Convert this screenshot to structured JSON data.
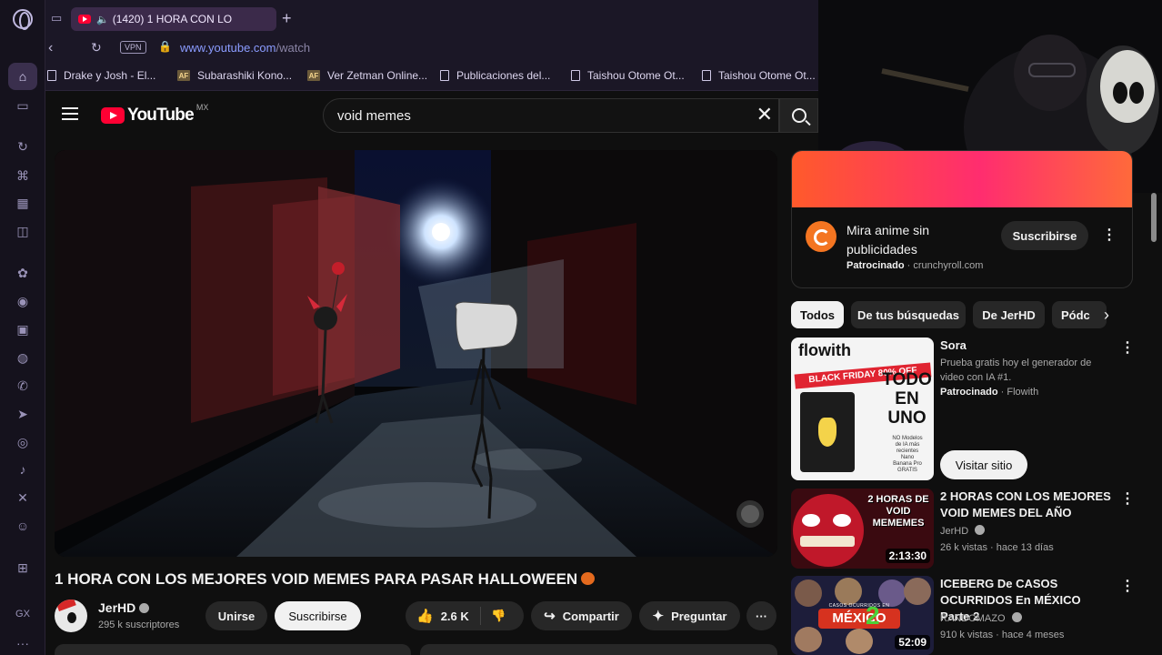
{
  "browser": {
    "tab_title": "(1420) 1 HORA CON LO",
    "new_tab": "+",
    "vpn_label": "VPN",
    "url_host": "www.youtube.com",
    "url_path": "/watch",
    "bookmarks": [
      {
        "label": "Drake y Josh - El...",
        "icon": "page-icon"
      },
      {
        "label": "Subarashiki Kono...",
        "icon": "af"
      },
      {
        "label": "Ver Zetman Online...",
        "icon": "af"
      },
      {
        "label": "Publicaciones del...",
        "icon": "page-icon"
      },
      {
        "label": "Taishou Otome Ot...",
        "icon": "page-icon"
      },
      {
        "label": "Taishou Otome Ot...",
        "icon": "page-icon"
      }
    ],
    "bookmark_af_text": "AF"
  },
  "sidebar": {
    "gx_label": "GX",
    "more_label": "···"
  },
  "youtube": {
    "logo_text": "YouTube",
    "country_code": "MX",
    "search_query": "void memes",
    "clear_symbol": "✕"
  },
  "video": {
    "title": "1 HORA CON LOS MEJORES VOID MEMES PARA PASAR HALLOWEEN",
    "channel": "JerHD",
    "subscribers": "295 k suscriptores",
    "join_label": "Unirse",
    "subscribe_label": "Suscribirse",
    "likes": "2.6 K",
    "share_label": "Compartir",
    "ask_label": "Preguntar",
    "more_label": "···"
  },
  "ad": {
    "title": "Mira anime sin publicidades",
    "sponsored": "Patrocinado",
    "domain": "crunchyroll.com",
    "subscribe_label": "Suscribirse"
  },
  "chips": [
    "Todos",
    "De tus búsquedas",
    "De JerHD",
    "Pódc"
  ],
  "recommendations": [
    {
      "title": "Sora",
      "description": "Prueba gratis hoy el generador de video con IA #1.",
      "sponsored": "Patrocinado",
      "advertiser": "Flowith",
      "button": "Visitar sitio",
      "thumb_brand": "flowith",
      "thumb_banner": "BLACK FRIDAY 80% OFF",
      "thumb_big": [
        "TODO",
        "EN",
        "UNO"
      ],
      "thumb_small": [
        "NO Modelos",
        "de IA más",
        "recientes",
        "Nano",
        "Banana Pro",
        "GRATIS"
      ]
    },
    {
      "title": "2 HORAS CON LOS MEJORES VOID MEMES DEL AÑO",
      "channel": "JerHD",
      "meta": "26 k vistas · hace 13 días",
      "duration": "2:13:30",
      "thumb_text_1": "2 HORAS DE",
      "thumb_text_2": "VOID MEMEMES"
    },
    {
      "title": "ICEBERG De CASOS OCURRIDOS En MÉXICO Parte 2",
      "channel": "RANDOMAZO",
      "meta": "910 k vistas · hace 4 meses",
      "duration": "52:09",
      "thumb_text_1": "CASOS OCURRIDOS EN",
      "thumb_text_2": "MÉXICO",
      "thumb_text_3": "2"
    }
  ],
  "colors": {
    "yt_red": "#ff0033",
    "background": "#0f0f0f",
    "opera_accent": "#3b2a4a",
    "crunchyroll_orange": "#f47521"
  }
}
